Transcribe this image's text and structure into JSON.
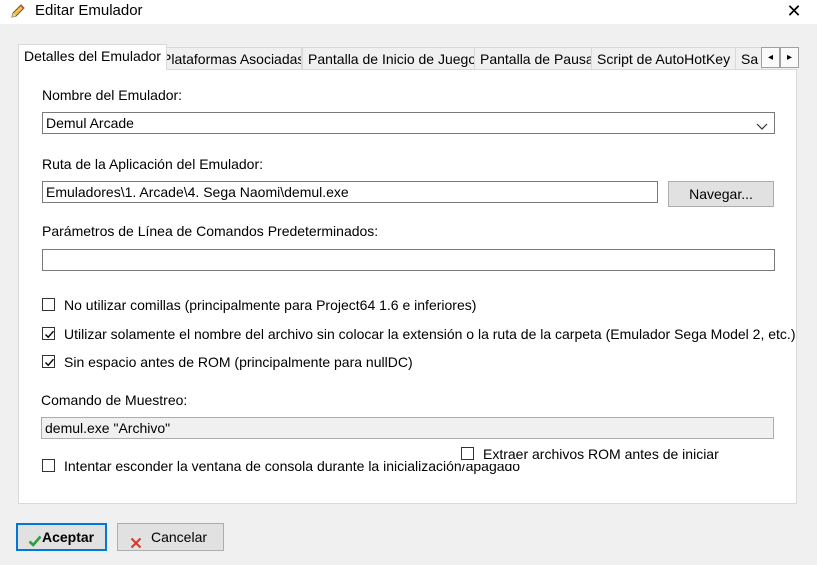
{
  "window": {
    "title": "Editar Emulador",
    "icon": "pencil-icon",
    "close_glyph": "✕"
  },
  "tabs": [
    {
      "label": "Detalles del Emulador",
      "active": true
    },
    {
      "label": "Plataformas Asociadas",
      "active": false
    },
    {
      "label": "Pantalla de Inicio de Juego",
      "active": false
    },
    {
      "label": "Pantalla de Pausa",
      "active": false
    },
    {
      "label": "Script de AutoHotKey",
      "active": false
    },
    {
      "label": "Sa",
      "active": false
    }
  ],
  "tab_scroll": {
    "left_glyph": "◂",
    "right_glyph": "▸"
  },
  "form": {
    "name_label": "Nombre del Emulador:",
    "name_value": "Demul Arcade",
    "path_label": "Ruta de la Aplicación del Emulador:",
    "path_value": "Emuladores\\1. Arcade\\4. Sega Naomi\\demul.exe",
    "browse_label": "Navegar...",
    "params_label": "Parámetros de Línea de Comandos Predeterminados:",
    "params_value": "",
    "checkbox_no_quotes": {
      "label": "No utilizar comillas (principalmente para Project64 1.6 e inferiores)",
      "checked": false
    },
    "checkbox_filename_only": {
      "label": "Utilizar solamente el nombre del archivo sin colocar la extensión o la ruta de la carpeta  (Emulador Sega Model 2, etc.)",
      "checked": true
    },
    "checkbox_no_space": {
      "label": "Sin espacio antes de ROM (principalmente para nullDC)",
      "checked": true
    },
    "sample_label": "Comando de Muestreo:",
    "sample_value": "demul.exe \"Archivo\"",
    "checkbox_extract_roms": {
      "label": "Extraer archivos ROM antes de iniciar",
      "checked": false
    },
    "checkbox_hide_console": {
      "label": "Intentar esconder la ventana de consola durante la inicialización/apagado",
      "checked": false
    }
  },
  "footer": {
    "accept_label": "Aceptar",
    "cancel_label": "Cancelar"
  },
  "colors": {
    "accent": "#0078d7",
    "ok_green": "#2e9e3e",
    "cancel_red": "#d9362b"
  }
}
